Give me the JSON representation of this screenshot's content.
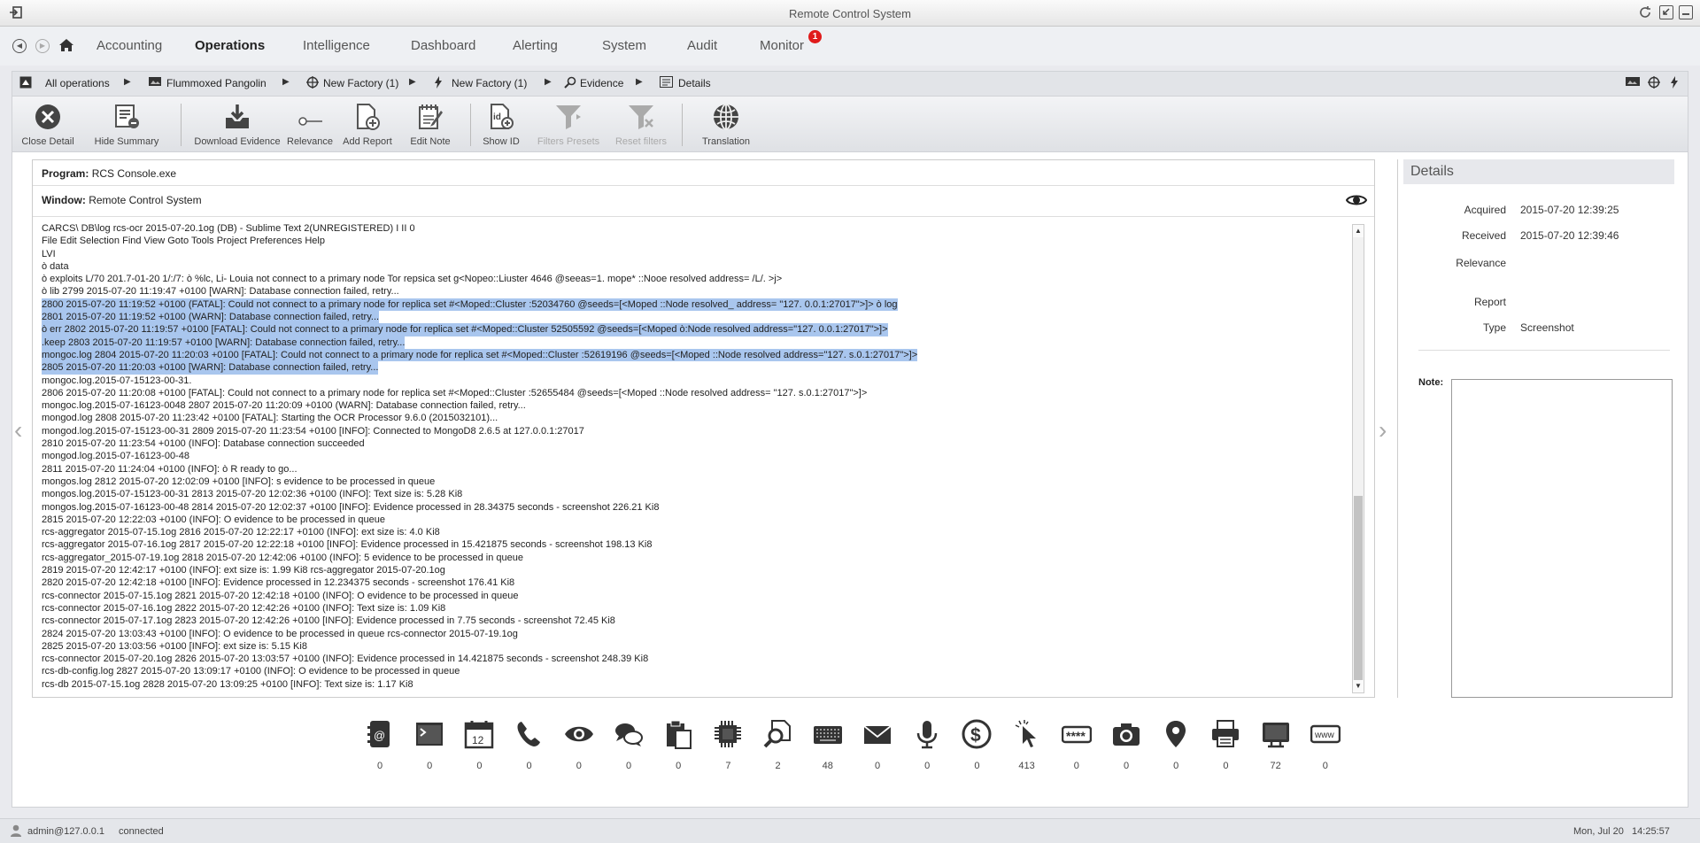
{
  "window": {
    "title": "Remote Control System"
  },
  "nav": {
    "items": [
      "Accounting",
      "Operations",
      "Intelligence",
      "Dashboard",
      "Alerting",
      "System",
      "Audit",
      "Monitor"
    ],
    "active": "Operations",
    "monitor_badge": "1"
  },
  "breadcrumb": [
    "All operations",
    "Flummoxed Pangolin",
    "New Factory (1)",
    "New Factory (1)",
    "Evidence",
    "Details"
  ],
  "toolbar": {
    "close_detail": "Close Detail",
    "hide_summary": "Hide Summary",
    "download_evidence": "Download Evidence",
    "relevance": "Relevance",
    "add_report": "Add Report",
    "edit_note": "Edit Note",
    "show_id": "Show ID",
    "filters_presets": "Filters Presets",
    "reset_filters": "Reset filters",
    "translation": "Translation"
  },
  "evidence": {
    "program_label": "Program:",
    "program": "RCS Console.exe",
    "window_label": "Window:",
    "window": "Remote Control System",
    "lines": [
      {
        "t": "CARCS\\ DB\\log rcs-ocr 2015-07-20.1og (DB) - Sublime Text 2(UNREGISTERED) I II 0",
        "hl": false
      },
      {
        "t": "File Edit Selection Find View Goto Tools Project Preferences Help",
        "hl": false
      },
      {
        "t": "LVI",
        "hl": false
      },
      {
        "t": "ò data",
        "hl": false
      },
      {
        "t": "ò exploits L/70 201.7-01-20 1/:/7: ò %lc, Li- Louia not connect to a primary node Tor repsica set g<Nopeo::Liuster 4646 @seeas=1. mope* ::Nooe resolved address= /L/. >j>",
        "hl": false
      },
      {
        "t": "ò lib 2799 2015-07-20 11:19:47 +0100 [WARN]: Database connection failed, retry...",
        "hl": false
      },
      {
        "t": "2800 2015-07-20 11:19:52 +0100 (FATAL]: Could not connect to a primary node for replica set #<Moped::Cluster :52034760 @seeds=[<Moped ::Node resolved_ address= \"127. 0.0.1:27017\">]> ò log",
        "hl": true
      },
      {
        "t": "2801 2015-07-20 11:19:52 +0100 (WARN]: Database connection failed, retry...",
        "hl": true
      },
      {
        "t": "ò err 2802 2015-07-20 11:19:57 +0100 [FATAL]: Could not connect to a primary node for replica set #<Moped::Cluster 52505592 @seeds=[<Moped ò:Node resolved address=\"127. 0.0.1:27017\">]>",
        "hl": true
      },
      {
        "t": ".keep 2803 2015-07-20 11:19:57 +0100 [WARN]: Database connection failed, retry...",
        "hl": true
      },
      {
        "t": "mongoc.log 2804 2015-07-20 11:20:03 +0100 [FATAL]: Could not connect to a primary node for replica set #<Moped::Cluster :52619196 @seeds=[<Moped ::Node resolved address=\"127. s.0.1:27017\">]>",
        "hl": true
      },
      {
        "t": "2805 2015-07-20 11:20:03 +0100 [WARN]: Database connection failed, retry...",
        "hl": true
      },
      {
        "t": "mongoc.log.2015-07-15123-00-31.",
        "hl": false
      },
      {
        "t": "2806 2015-07-20 11:20:08 +0100 [FATAL]: Could not connect to a primary node for replica set #<Moped::Cluster :52655484 @seeds=[<Moped ::Node resolved address= \"127. s.0.1:27017\">]>",
        "hl": false
      },
      {
        "t": "mongoc.log.2015-07-16123-0048 2807 2015-07-20 11:20:09 +0100 (WARN]: Database connection failed, retry...",
        "hl": false
      },
      {
        "t": "mongod.log 2808 2015-07-20 11:23:42 +0100 [FATAL]: Starting the OCR Processor 9.6.0 (2015032101)...",
        "hl": false
      },
      {
        "t": "mongod.log.2015-07-15123-00-31 2809 2015-07-20 11:23:54 +0100 [INFO]: Connected to MongoD8 2.6.5 at 127.0.0.1:27017",
        "hl": false
      },
      {
        "t": "2810 2015-07-20 11:23:54 +0100 (INFO]: Database connection succeeded",
        "hl": false
      },
      {
        "t": "mongod.log.2015-07-16123-00-48",
        "hl": false
      },
      {
        "t": "2811 2015-07-20 11:24:04 +0100 (INFO]: ò R ready to go...",
        "hl": false
      },
      {
        "t": "mongos.log 2812 2015-07-20 12:02:09 +0100 [INFO]: s evidence to be processed in queue",
        "hl": false
      },
      {
        "t": "mongos.log.2015-07-15123-00-31 2813 2015-07-20 12:02:36 +0100 (INFO]: Text size is: 5.28 Ki8",
        "hl": false
      },
      {
        "t": "mongos.log.2015-07-16123-00-48 2814 2015-07-20 12:02:37 +0100 [INFO]: Evidence processed in 28.34375 seconds - screenshot 226.21 Ki8",
        "hl": false
      },
      {
        "t": "2815 2015-07-20 12:22:03 +0100 (INFO]: O evidence to be processed in queue",
        "hl": false
      },
      {
        "t": "rcs-aggregator 2015-07-15.1og 2816 2015-07-20 12:22:17 +0100 (INFO]: ext size is: 4.0 Ki8",
        "hl": false
      },
      {
        "t": "rcs-aggregator 2015-07-16.1og 2817 2015-07-20 12:22:18 +0100 [INFO]: Evidence processed in 15.421875 seconds - screenshot 198.13 Ki8",
        "hl": false
      },
      {
        "t": "rcs-aggregator_2015-07-19.1og 2818 2015-07-20 12:42:06 +0100 (INFO]: 5 evidence to be processed in queue",
        "hl": false
      },
      {
        "t": "2819 2015-07-20 12:42:17 +0100 (INFO]: ext size is: 1.99 Ki8 rcs-aggregator 2015-07-20.1og",
        "hl": false
      },
      {
        "t": "2820 2015-07-20 12:42:18 +0100 [INFO]: Evidence processed in 12.234375 seconds - screenshot 176.41 Ki8",
        "hl": false
      },
      {
        "t": "rcs-connector 2015-07-15.1og 2821 2015-07-20 12:42:18 +0100 (INFO]: O evidence to be processed in queue",
        "hl": false
      },
      {
        "t": "rcs-connector 2015-07-16.1og 2822 2015-07-20 12:42:26 +0100 (INFO]: Text size is: 1.09 Ki8",
        "hl": false
      },
      {
        "t": "rcs-connector 2015-07-17.1og 2823 2015-07-20 12:42:26 +0100 [INFO]: Evidence processed in 7.75 seconds - screenshot 72.45 Ki8",
        "hl": false
      },
      {
        "t": "2824 2015-07-20 13:03:43 +0100 [INFO]: O evidence to be processed in queue rcs-connector 2015-07-19.1og",
        "hl": false
      },
      {
        "t": "2825 2015-07-20 13:03:56 +0100 [INFO]: ext size is: 5.15 Ki8",
        "hl": false
      },
      {
        "t": "rcs-connector 2015-07-20.1og 2826 2015-07-20 13:03:57 +0100 (INFO]: Evidence processed in 14.421875 seconds - screenshot 248.39 Ki8",
        "hl": false
      },
      {
        "t": "rcs-db-config.log 2827 2015-07-20 13:09:17 +0100 (INFO]: O evidence to be processed in queue",
        "hl": false
      },
      {
        "t": "rcs-db 2015-07-15.1og 2828 2015-07-20 13:09:25 +0100 [INFO]: Text size is: 1.17 Ki8",
        "hl": false
      }
    ]
  },
  "details": {
    "title": "Details",
    "acquired_label": "Acquired",
    "acquired": "2015-07-20 12:39:25",
    "received_label": "Received",
    "received": "2015-07-20 12:39:46",
    "relevance_label": "Relevance",
    "report_label": "Report",
    "type_label": "Type",
    "type": "Screenshot",
    "note_label": "Note:"
  },
  "evidence_types": [
    {
      "icon": "addressbook-icon",
      "count": "0"
    },
    {
      "icon": "terminal-icon",
      "count": "0"
    },
    {
      "icon": "calendar-icon",
      "count": "0",
      "text": "12"
    },
    {
      "icon": "phone-icon",
      "count": "0"
    },
    {
      "icon": "eye-icon",
      "count": "0"
    },
    {
      "icon": "chat-icon",
      "count": "0"
    },
    {
      "icon": "clipboard-icon",
      "count": "0"
    },
    {
      "icon": "chip-icon",
      "count": "7"
    },
    {
      "icon": "file-search-icon",
      "count": "2"
    },
    {
      "icon": "keyboard-icon",
      "count": "48"
    },
    {
      "icon": "mail-icon",
      "count": "0"
    },
    {
      "icon": "microphone-icon",
      "count": "0"
    },
    {
      "icon": "money-icon",
      "count": "0"
    },
    {
      "icon": "mouse-click-icon",
      "count": "413"
    },
    {
      "icon": "password-icon",
      "count": "0",
      "text": "****"
    },
    {
      "icon": "camera-icon",
      "count": "0"
    },
    {
      "icon": "location-icon",
      "count": "0"
    },
    {
      "icon": "printer-icon",
      "count": "0"
    },
    {
      "icon": "screenshot-icon",
      "count": "72"
    },
    {
      "icon": "url-icon",
      "count": "0",
      "text": "www"
    }
  ],
  "status": {
    "user": "admin@127.0.0.1",
    "state": "connected",
    "clock": "Mon, Jul 20   14:25:57"
  },
  "colors": {
    "highlight": "#a9c6ee",
    "badge": "#e01b1b"
  }
}
